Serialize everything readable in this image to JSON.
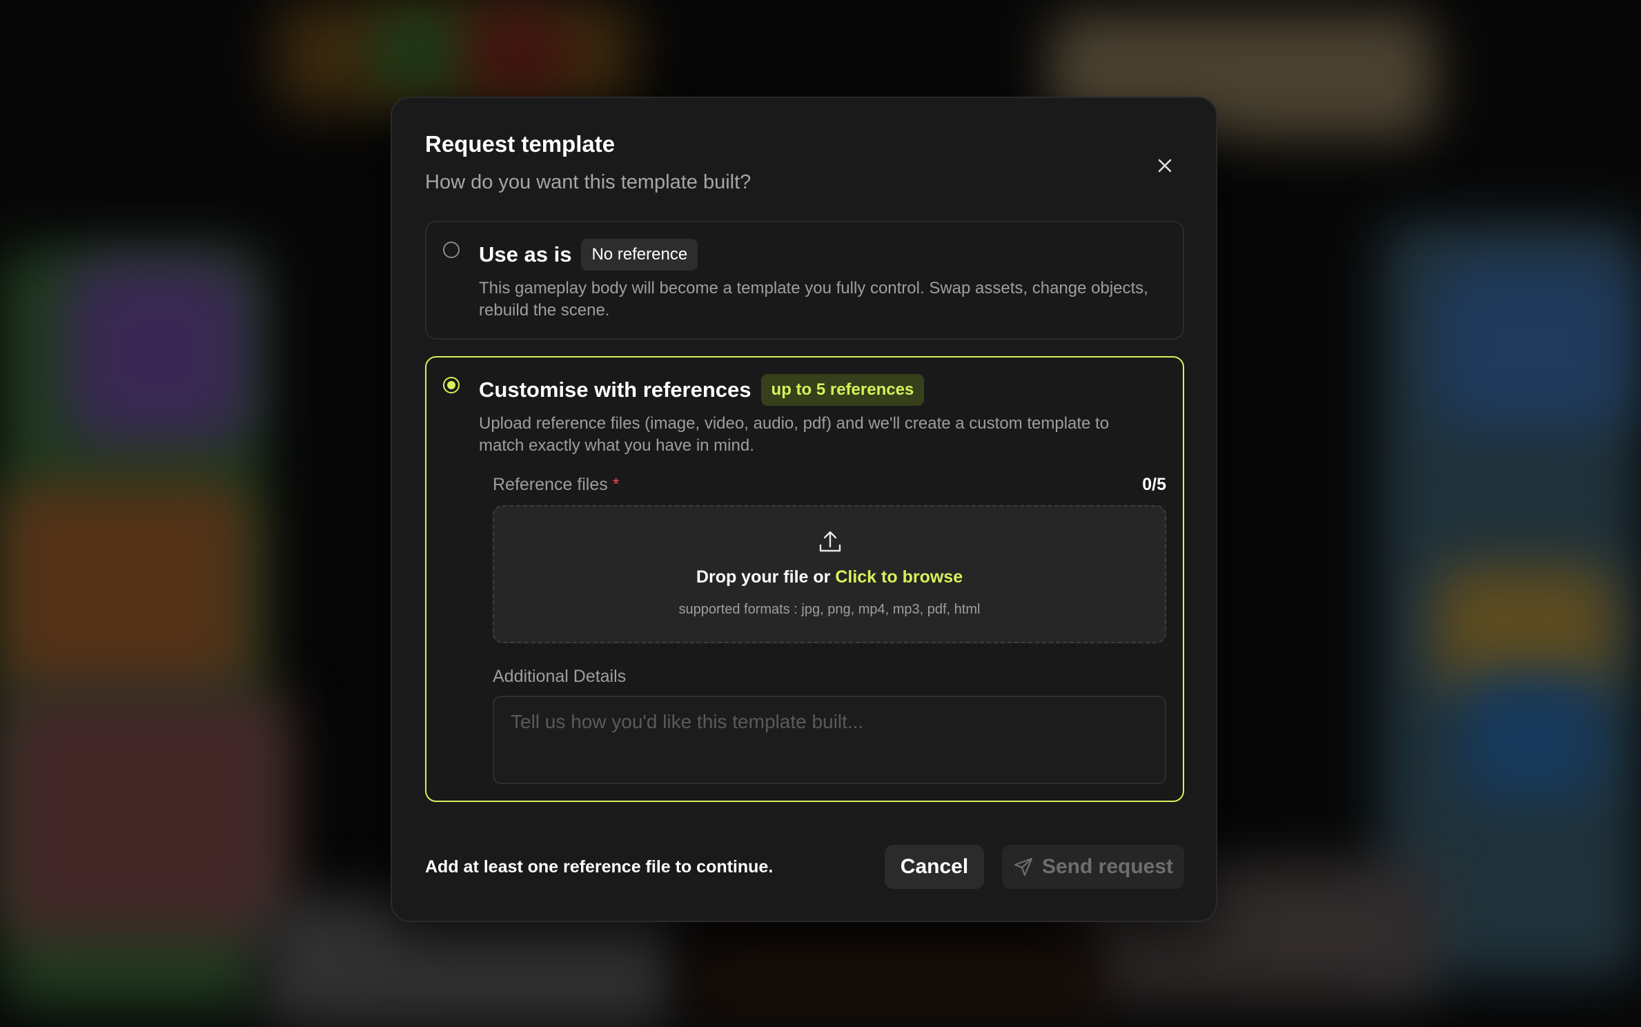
{
  "modal": {
    "title": "Request template",
    "subtitle": "How do you want this template built?"
  },
  "options": [
    {
      "title": "Use as is",
      "badge": "No reference",
      "description": "This gameplay body will become a template you fully control. Swap assets, change objects, rebuild the scene.",
      "selected": false
    },
    {
      "title": "Customise with references",
      "badge": "up to 5 references",
      "description": "Upload reference files (image, video, audio, pdf) and we'll create a custom template to match exactly what you have in mind.",
      "selected": true
    }
  ],
  "references": {
    "label": "Reference files",
    "required_mark": "*",
    "count": "0/5",
    "drop_text": "Drop your file or",
    "browse_text": "Click to browse",
    "formats": "supported formats : jpg, png, mp4, mp3, pdf, html"
  },
  "details": {
    "label": "Additional Details",
    "placeholder": "Tell us how you'd like this template built..."
  },
  "footer": {
    "message": "Add at least one reference file to continue.",
    "cancel_label": "Cancel",
    "send_label": "Send request"
  },
  "colors": {
    "accent": "#d6f25a",
    "modal_bg": "#1a1a1a",
    "required": "#e5484d"
  }
}
